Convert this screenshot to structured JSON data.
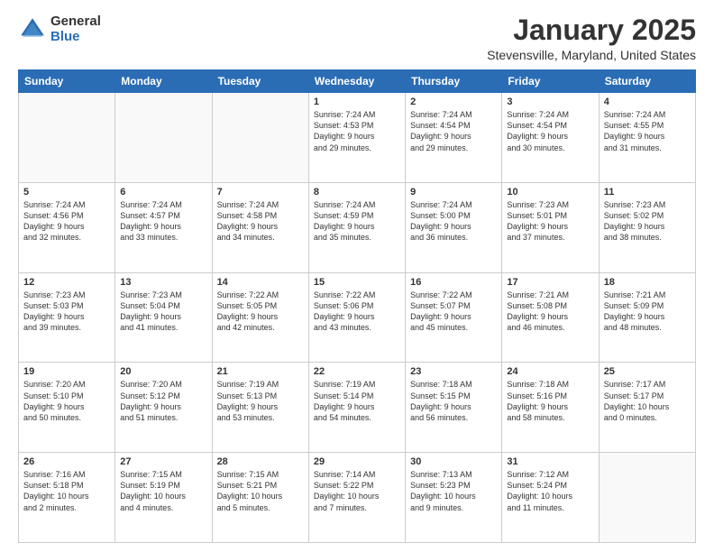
{
  "logo": {
    "general": "General",
    "blue": "Blue"
  },
  "header": {
    "title": "January 2025",
    "location": "Stevensville, Maryland, United States"
  },
  "weekdays": [
    "Sunday",
    "Monday",
    "Tuesday",
    "Wednesday",
    "Thursday",
    "Friday",
    "Saturday"
  ],
  "weeks": [
    [
      {
        "day": "",
        "info": ""
      },
      {
        "day": "",
        "info": ""
      },
      {
        "day": "",
        "info": ""
      },
      {
        "day": "1",
        "info": "Sunrise: 7:24 AM\nSunset: 4:53 PM\nDaylight: 9 hours\nand 29 minutes."
      },
      {
        "day": "2",
        "info": "Sunrise: 7:24 AM\nSunset: 4:54 PM\nDaylight: 9 hours\nand 29 minutes."
      },
      {
        "day": "3",
        "info": "Sunrise: 7:24 AM\nSunset: 4:54 PM\nDaylight: 9 hours\nand 30 minutes."
      },
      {
        "day": "4",
        "info": "Sunrise: 7:24 AM\nSunset: 4:55 PM\nDaylight: 9 hours\nand 31 minutes."
      }
    ],
    [
      {
        "day": "5",
        "info": "Sunrise: 7:24 AM\nSunset: 4:56 PM\nDaylight: 9 hours\nand 32 minutes."
      },
      {
        "day": "6",
        "info": "Sunrise: 7:24 AM\nSunset: 4:57 PM\nDaylight: 9 hours\nand 33 minutes."
      },
      {
        "day": "7",
        "info": "Sunrise: 7:24 AM\nSunset: 4:58 PM\nDaylight: 9 hours\nand 34 minutes."
      },
      {
        "day": "8",
        "info": "Sunrise: 7:24 AM\nSunset: 4:59 PM\nDaylight: 9 hours\nand 35 minutes."
      },
      {
        "day": "9",
        "info": "Sunrise: 7:24 AM\nSunset: 5:00 PM\nDaylight: 9 hours\nand 36 minutes."
      },
      {
        "day": "10",
        "info": "Sunrise: 7:23 AM\nSunset: 5:01 PM\nDaylight: 9 hours\nand 37 minutes."
      },
      {
        "day": "11",
        "info": "Sunrise: 7:23 AM\nSunset: 5:02 PM\nDaylight: 9 hours\nand 38 minutes."
      }
    ],
    [
      {
        "day": "12",
        "info": "Sunrise: 7:23 AM\nSunset: 5:03 PM\nDaylight: 9 hours\nand 39 minutes."
      },
      {
        "day": "13",
        "info": "Sunrise: 7:23 AM\nSunset: 5:04 PM\nDaylight: 9 hours\nand 41 minutes."
      },
      {
        "day": "14",
        "info": "Sunrise: 7:22 AM\nSunset: 5:05 PM\nDaylight: 9 hours\nand 42 minutes."
      },
      {
        "day": "15",
        "info": "Sunrise: 7:22 AM\nSunset: 5:06 PM\nDaylight: 9 hours\nand 43 minutes."
      },
      {
        "day": "16",
        "info": "Sunrise: 7:22 AM\nSunset: 5:07 PM\nDaylight: 9 hours\nand 45 minutes."
      },
      {
        "day": "17",
        "info": "Sunrise: 7:21 AM\nSunset: 5:08 PM\nDaylight: 9 hours\nand 46 minutes."
      },
      {
        "day": "18",
        "info": "Sunrise: 7:21 AM\nSunset: 5:09 PM\nDaylight: 9 hours\nand 48 minutes."
      }
    ],
    [
      {
        "day": "19",
        "info": "Sunrise: 7:20 AM\nSunset: 5:10 PM\nDaylight: 9 hours\nand 50 minutes."
      },
      {
        "day": "20",
        "info": "Sunrise: 7:20 AM\nSunset: 5:12 PM\nDaylight: 9 hours\nand 51 minutes."
      },
      {
        "day": "21",
        "info": "Sunrise: 7:19 AM\nSunset: 5:13 PM\nDaylight: 9 hours\nand 53 minutes."
      },
      {
        "day": "22",
        "info": "Sunrise: 7:19 AM\nSunset: 5:14 PM\nDaylight: 9 hours\nand 54 minutes."
      },
      {
        "day": "23",
        "info": "Sunrise: 7:18 AM\nSunset: 5:15 PM\nDaylight: 9 hours\nand 56 minutes."
      },
      {
        "day": "24",
        "info": "Sunrise: 7:18 AM\nSunset: 5:16 PM\nDaylight: 9 hours\nand 58 minutes."
      },
      {
        "day": "25",
        "info": "Sunrise: 7:17 AM\nSunset: 5:17 PM\nDaylight: 10 hours\nand 0 minutes."
      }
    ],
    [
      {
        "day": "26",
        "info": "Sunrise: 7:16 AM\nSunset: 5:18 PM\nDaylight: 10 hours\nand 2 minutes."
      },
      {
        "day": "27",
        "info": "Sunrise: 7:15 AM\nSunset: 5:19 PM\nDaylight: 10 hours\nand 4 minutes."
      },
      {
        "day": "28",
        "info": "Sunrise: 7:15 AM\nSunset: 5:21 PM\nDaylight: 10 hours\nand 5 minutes."
      },
      {
        "day": "29",
        "info": "Sunrise: 7:14 AM\nSunset: 5:22 PM\nDaylight: 10 hours\nand 7 minutes."
      },
      {
        "day": "30",
        "info": "Sunrise: 7:13 AM\nSunset: 5:23 PM\nDaylight: 10 hours\nand 9 minutes."
      },
      {
        "day": "31",
        "info": "Sunrise: 7:12 AM\nSunset: 5:24 PM\nDaylight: 10 hours\nand 11 minutes."
      },
      {
        "day": "",
        "info": ""
      }
    ]
  ]
}
